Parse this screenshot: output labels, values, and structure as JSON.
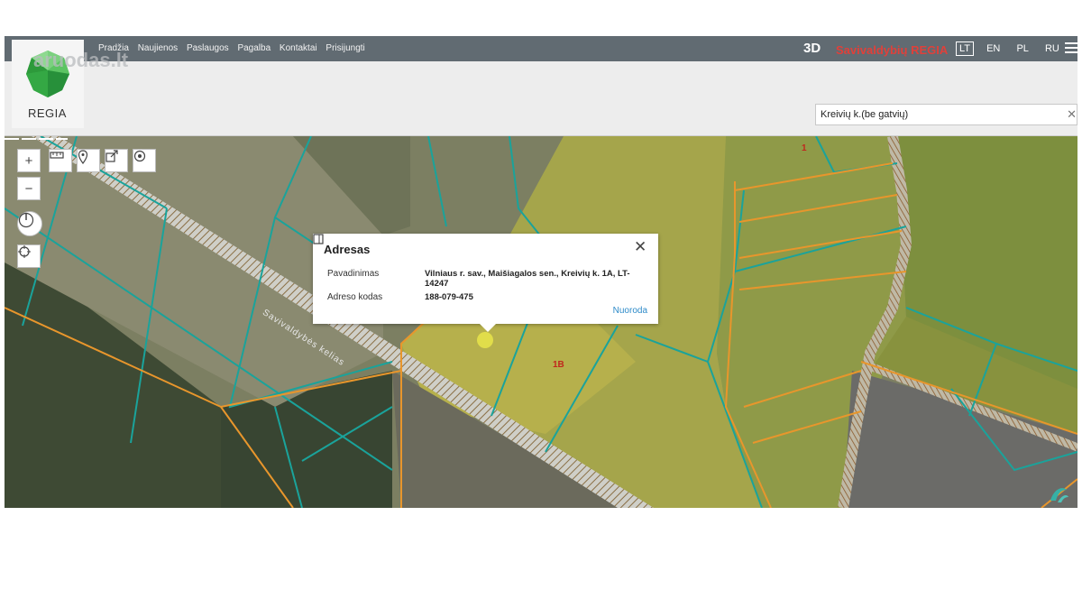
{
  "nav": {
    "items": [
      "Pradžia",
      "Naujienos",
      "Paslaugos",
      "Pagalba",
      "Kontaktai",
      "Prisijungti"
    ],
    "three_d": "3D",
    "brand": "Savivaldybių REGIA",
    "languages": [
      "LT",
      "EN",
      "PL",
      "RU"
    ],
    "active_language": "LT"
  },
  "logo": {
    "text": "REGIA",
    "watermark": "aruodas.lt"
  },
  "search": {
    "value": "Kreivių k.(be gatvių)"
  },
  "popup": {
    "title": "Adresas",
    "rows": [
      {
        "label": "Pavadinimas",
        "value": "Vilniaus r. sav., Maišiagalos sen., Kreivių k. 1A, LT-14247"
      },
      {
        "label": "Adreso kodas",
        "value": "188-079-475"
      }
    ],
    "link": "Nuoroda"
  },
  "map": {
    "labels": [
      "1B",
      "1",
      "1"
    ],
    "road_label": "Savivaldybės kelias",
    "colors": {
      "parcel_line": "#1aa39b",
      "boundary": "#e8962c",
      "highlight": "#c9c23a"
    }
  }
}
